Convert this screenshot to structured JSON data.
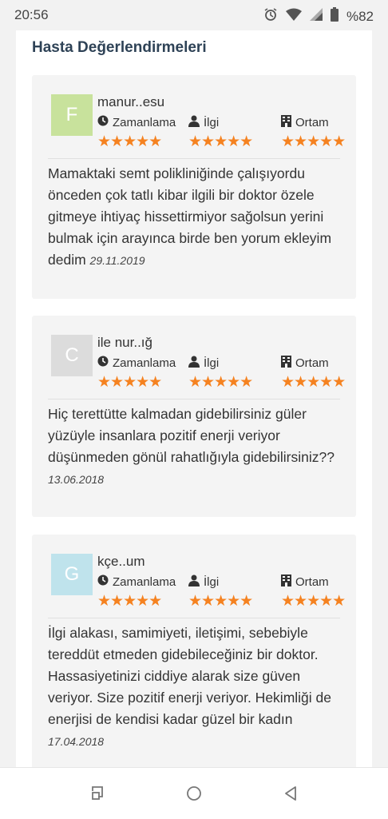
{
  "status_bar": {
    "time": "20:56",
    "battery": "%82",
    "icons": [
      "alarm-icon",
      "wifi-icon",
      "signal-icon",
      "battery-icon"
    ]
  },
  "section": {
    "title": "Hasta Değerlendirmeleri"
  },
  "criteria": {
    "c1": "Zamanlama",
    "c2": "İlgi",
    "c3": "Ortam"
  },
  "colors": {
    "star": "#f58220",
    "title": "#2e4256"
  },
  "reviews": [
    {
      "initial": "F",
      "avatar_color": "#c8e29c",
      "name": "manur..esu",
      "ratings": [
        5,
        5,
        5
      ],
      "stars_text": "★★★★★",
      "text": "Mamaktaki semt polikliniğinde çalışıyordu önceden çok tatlı kibar ilgili bir doktor özele gitmeye ihtiyaç hissettirmiyor sağolsun yerini bulmak için arayınca birde ben yorum ekleyim dedim",
      "date": "29.11.2019"
    },
    {
      "initial": "C",
      "avatar_color": "#dcdcdc",
      "name": "ile nur..ığ",
      "ratings": [
        5,
        5,
        5
      ],
      "stars_text": "★★★★★",
      "text": "Hiç terettütte kalmadan gidebilirsiniz güler yüzüyle insanlara pozitif enerji veriyor düşünmeden gönül rahatlığıyla gidebilirsiniz??",
      "date": "13.06.2018"
    },
    {
      "initial": "G",
      "avatar_color": "#bfe3ec",
      "name": "kçe..um",
      "ratings": [
        5,
        5,
        5
      ],
      "stars_text": "★★★★★",
      "text": "İlgi alakası, samimiyeti, iletişimi, sebebiyle tereddüt etmeden gidebileceğiniz bir doktor. Hassasiyetinizi ciddiye alarak size güven veriyor. Size pozitif enerji veriyor. Hekimliği de enerjisi de kendisi kadar güzel bir kadın",
      "date": "17.04.2018"
    }
  ],
  "nav": {
    "icons": [
      "recents-icon",
      "home-icon",
      "back-icon"
    ]
  }
}
